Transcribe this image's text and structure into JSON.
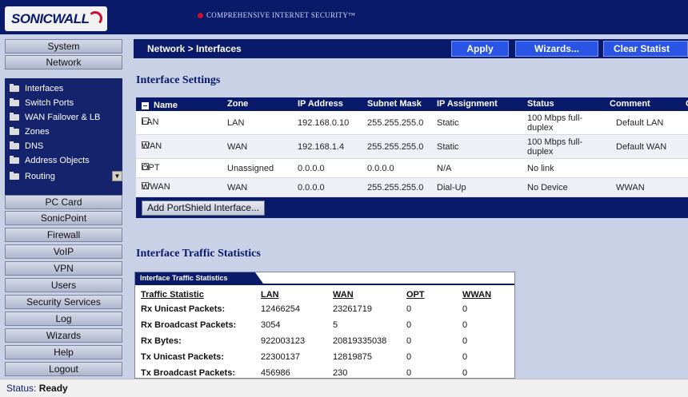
{
  "banner": {
    "logo_text": "SONICWALL",
    "tagline": "COMPREHENSIVE INTERNET SECURITY™",
    "brand_color": "#0a1a6b"
  },
  "sidebar": {
    "top_buttons": [
      "System",
      "Network"
    ],
    "network_items": [
      {
        "label": "Interfaces",
        "icon": "folder-open-icon"
      },
      {
        "label": "Switch Ports",
        "icon": "folder-icon"
      },
      {
        "label": "WAN Failover & LB",
        "icon": "folder-icon"
      },
      {
        "label": "Zones",
        "icon": "folder-icon"
      },
      {
        "label": "DNS",
        "icon": "folder-icon"
      },
      {
        "label": "Address Objects",
        "icon": "folder-icon"
      },
      {
        "label": "Routing",
        "icon": "folder-icon"
      }
    ],
    "scroll_glyph": "▼",
    "bottom_buttons": [
      "PC Card",
      "SonicPoint",
      "Firewall",
      "VoIP",
      "VPN",
      "Users",
      "Security Services",
      "Log",
      "Wizards",
      "Help",
      "Logout"
    ]
  },
  "toolbar": {
    "breadcrumb": "Network > Interfaces",
    "apply_label": "Apply",
    "wizards_label": "Wizards...",
    "clear_label": "Clear Statist"
  },
  "interface_settings": {
    "title": "Interface Settings",
    "columns": [
      "Name",
      "Zone",
      "IP Address",
      "Subnet Mask",
      "IP Assignment",
      "Status",
      "Comment",
      "C"
    ],
    "rows": [
      {
        "name": "LAN",
        "zone": "LAN",
        "ip": "192.168.0.10",
        "mask": "255.255.255.0",
        "assign": "Static",
        "status": "100 Mbps full-duplex",
        "comment": "Default LAN"
      },
      {
        "name": "WAN",
        "zone": "WAN",
        "ip": "192.168.1.4",
        "mask": "255.255.255.0",
        "assign": "Static",
        "status": "100 Mbps full-duplex",
        "comment": "Default WAN"
      },
      {
        "name": "OPT",
        "zone": "Unassigned",
        "ip": "0.0.0.0",
        "mask": "0.0.0.0",
        "assign": "N/A",
        "status": "No link",
        "comment": ""
      },
      {
        "name": "WWAN",
        "zone": "WAN",
        "ip": "0.0.0.0",
        "mask": "255.255.255.0",
        "assign": "Dial-Up",
        "status": "No Device",
        "comment": "WWAN"
      }
    ],
    "add_button": "Add PortShield Interface..."
  },
  "traffic_stats": {
    "title": "Interface Traffic Statistics",
    "tab_label": "Interface Traffic Statistics",
    "columns": [
      "Traffic Statistic",
      "LAN",
      "WAN",
      "OPT",
      "WWAN"
    ],
    "rows": [
      {
        "stat": "Rx Unicast Packets:",
        "lan": "12466254",
        "wan": "23261719",
        "opt": "0",
        "wwan": "0"
      },
      {
        "stat": "Rx Broadcast Packets:",
        "lan": "3054",
        "wan": "5",
        "opt": "0",
        "wwan": "0"
      },
      {
        "stat": "Rx Bytes:",
        "lan": "922003123",
        "wan": "20819335038",
        "opt": "0",
        "wwan": "0"
      },
      {
        "stat": "Tx Unicast Packets:",
        "lan": "22300137",
        "wan": "12819875",
        "opt": "0",
        "wwan": "0"
      },
      {
        "stat": "Tx Broadcast Packets:",
        "lan": "456986",
        "wan": "230",
        "opt": "0",
        "wwan": "0"
      }
    ]
  },
  "status": {
    "label": "Status:",
    "value": "Ready"
  }
}
